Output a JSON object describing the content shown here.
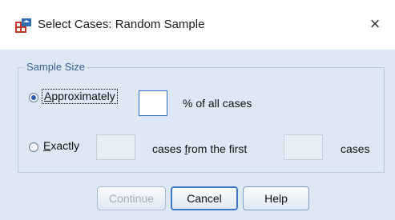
{
  "window": {
    "title": "Select Cases: Random Sample",
    "icon": "spss-select-cases-icon",
    "close_glyph": "×"
  },
  "group": {
    "legend": "Sample Size"
  },
  "options": {
    "approximately": {
      "label_ul": "A",
      "label_rest": "pproximately",
      "selected": true,
      "value": "",
      "suffix": "% of all cases"
    },
    "exactly": {
      "label_ul": "E",
      "label_rest": "xactly",
      "selected": false,
      "count_value": "",
      "middle_pre": "cases ",
      "middle_ul": "f",
      "middle_post": "rom the first",
      "first_value": "",
      "suffix": "cases"
    }
  },
  "buttons": {
    "continue": "Continue",
    "cancel": "Cancel",
    "help": "Help"
  },
  "colors": {
    "dialog_bg": "#dde8f4",
    "legend": "#3a5d93",
    "focus_border": "#2e6fd0"
  }
}
